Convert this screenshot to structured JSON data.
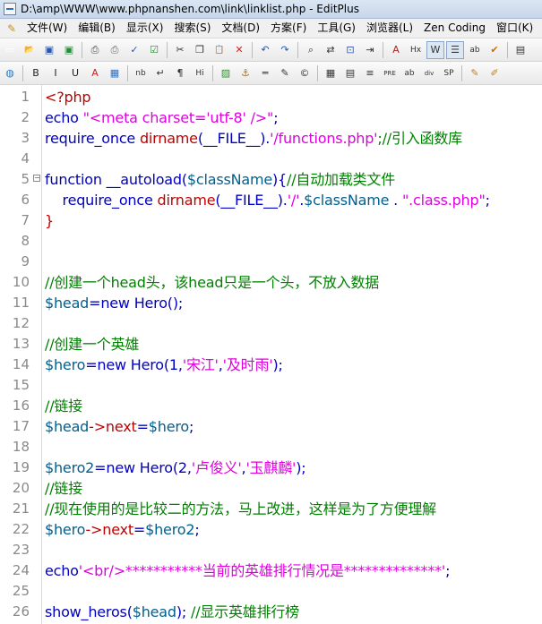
{
  "window": {
    "title": "D:\\amp\\WWW\\www.phpnanshen.com\\link\\linklist.php - EditPlus"
  },
  "menu": {
    "items": [
      {
        "label": "文件(W)"
      },
      {
        "label": "编辑(B)"
      },
      {
        "label": "显示(X)"
      },
      {
        "label": "搜索(S)"
      },
      {
        "label": "文档(D)"
      },
      {
        "label": "方案(F)"
      },
      {
        "label": "工具(G)"
      },
      {
        "label": "浏览器(L)"
      },
      {
        "label": "Zen Coding"
      },
      {
        "label": "窗口(K)"
      }
    ]
  },
  "toolbar1": {
    "buttons": [
      {
        "icon": "new-file-icon",
        "glyph": "▭",
        "color": "#ffffff"
      },
      {
        "icon": "open-folder-icon",
        "glyph": "📂",
        "color": "#e0b040"
      },
      {
        "icon": "save-icon",
        "glyph": "▣",
        "color": "#2a55a8"
      },
      {
        "icon": "save-all-icon",
        "glyph": "▣",
        "color": "#2a8a3a"
      },
      {
        "sep": true
      },
      {
        "icon": "print-icon",
        "glyph": "⎙",
        "color": "#444444"
      },
      {
        "icon": "print-preview-icon",
        "glyph": "⎙",
        "color": "#666666"
      },
      {
        "icon": "spell-check-icon",
        "glyph": "✓",
        "color": "#2a55a8"
      },
      {
        "icon": "check-icon",
        "glyph": "☑",
        "color": "#2a8a3a"
      },
      {
        "sep": true
      },
      {
        "icon": "cut-icon",
        "glyph": "✂",
        "color": "#333333"
      },
      {
        "icon": "copy-icon",
        "glyph": "❐",
        "color": "#333333"
      },
      {
        "icon": "paste-icon",
        "glyph": "📋",
        "color": "#a07030"
      },
      {
        "icon": "delete-icon",
        "glyph": "✕",
        "color": "#cc2222"
      },
      {
        "sep": true
      },
      {
        "icon": "undo-icon",
        "glyph": "↶",
        "color": "#2a55a8"
      },
      {
        "icon": "redo-icon",
        "glyph": "↷",
        "color": "#2a55a8"
      },
      {
        "sep": true
      },
      {
        "icon": "find-icon",
        "glyph": "⌕",
        "color": "#333333"
      },
      {
        "icon": "replace-icon",
        "glyph": "⇄",
        "color": "#333333"
      },
      {
        "icon": "find-in-files-icon",
        "glyph": "⊡",
        "color": "#2a55a8"
      },
      {
        "icon": "goto-line-icon",
        "glyph": "⇥",
        "color": "#333333"
      },
      {
        "sep": true
      },
      {
        "icon": "font-icon",
        "glyph": "A",
        "color": "#aa2222"
      },
      {
        "icon": "hex-icon",
        "glyph": "Hx",
        "color": "#333333"
      },
      {
        "icon": "word-wrap-icon",
        "glyph": "W",
        "color": "#333333",
        "pressed": true
      },
      {
        "icon": "ruler-icon",
        "glyph": "☰",
        "color": "#333333",
        "pressed": true
      },
      {
        "icon": "spell-toggle-icon",
        "glyph": "ab",
        "color": "#333333"
      },
      {
        "icon": "checkmark-icon",
        "glyph": "✔",
        "color": "#d26a00"
      },
      {
        "sep": true
      },
      {
        "icon": "toggle-panel-icon",
        "glyph": "▤",
        "color": "#333333"
      }
    ]
  },
  "toolbar2": {
    "buttons": [
      {
        "icon": "browser-icon",
        "glyph": "◍",
        "color": "#2a7ac0"
      },
      {
        "sep": true
      },
      {
        "icon": "bold-icon",
        "glyph": "B",
        "color": "#222222"
      },
      {
        "icon": "italic-icon",
        "glyph": "I",
        "color": "#222222"
      },
      {
        "icon": "underline-icon",
        "glyph": "U",
        "color": "#222222"
      },
      {
        "icon": "font-color-icon",
        "glyph": "A",
        "color": "#cc2222"
      },
      {
        "icon": "color-grid-icon",
        "glyph": "▦",
        "color": "#3070c0"
      },
      {
        "sep": true
      },
      {
        "icon": "nbsp-icon",
        "glyph": "nb",
        "color": "#333333"
      },
      {
        "icon": "break-icon",
        "glyph": "↵",
        "color": "#333333"
      },
      {
        "icon": "paragraph-icon",
        "glyph": "¶",
        "color": "#333333"
      },
      {
        "icon": "heading-icon",
        "glyph": "Hi",
        "color": "#333333"
      },
      {
        "sep": true
      },
      {
        "icon": "image-icon",
        "glyph": "▨",
        "color": "#3a8a3a"
      },
      {
        "icon": "anchor-icon",
        "glyph": "⚓",
        "color": "#a07030"
      },
      {
        "icon": "hr-icon",
        "glyph": "═",
        "color": "#333333"
      },
      {
        "icon": "comment-icon",
        "glyph": "✎",
        "color": "#333333"
      },
      {
        "icon": "copyright-icon",
        "glyph": "©",
        "color": "#333333"
      },
      {
        "sep": true
      },
      {
        "icon": "table-icon",
        "glyph": "▦",
        "color": "#333333"
      },
      {
        "icon": "form-icon",
        "glyph": "▤",
        "color": "#333333"
      },
      {
        "icon": "list-icon",
        "glyph": "≡",
        "color": "#333333"
      },
      {
        "icon": "pre-icon",
        "glyph": "PRE",
        "color": "#333333"
      },
      {
        "icon": "abbr-icon",
        "glyph": "ab",
        "color": "#333333"
      },
      {
        "icon": "div-icon",
        "glyph": "div",
        "color": "#333333"
      },
      {
        "icon": "span-icon",
        "glyph": "SP",
        "color": "#333333"
      },
      {
        "sep": true
      },
      {
        "icon": "edit-icon",
        "glyph": "✎",
        "color": "#c08020"
      },
      {
        "icon": "pencil-icon",
        "glyph": "✐",
        "color": "#c08020"
      }
    ]
  },
  "colors": {
    "keyword": "#0000c0",
    "string": "#e000e0",
    "comment": "#008000",
    "variable": "#006090",
    "func": "#c00000",
    "plain": "#000000",
    "linenum": "#8a8a8a"
  },
  "editor": {
    "lines": [
      {
        "n": "1",
        "tokens": [
          {
            "t": "<?php",
            "c": "func"
          }
        ]
      },
      {
        "n": "2",
        "tokens": [
          {
            "t": "echo ",
            "c": "keyword"
          },
          {
            "t": "\"<meta charset='utf-8' />\"",
            "c": "string"
          },
          {
            "t": ";",
            "c": "keyword"
          }
        ]
      },
      {
        "n": "3",
        "tokens": [
          {
            "t": "require_once ",
            "c": "keyword"
          },
          {
            "t": "dirname",
            "c": "func"
          },
          {
            "t": "(__FILE__).",
            "c": "keyword"
          },
          {
            "t": "'/functions.php'",
            "c": "string"
          },
          {
            "t": ";//引入函数库",
            "c": "comment"
          }
        ]
      },
      {
        "n": "4",
        "tokens": []
      },
      {
        "n": "5",
        "fold": true,
        "tokens": [
          {
            "t": "function __autoload(",
            "c": "keyword"
          },
          {
            "t": "$className",
            "c": "variable"
          },
          {
            "t": "){",
            "c": "keyword"
          },
          {
            "t": "//自动加载类文件",
            "c": "comment"
          }
        ]
      },
      {
        "n": "6",
        "tokens": [
          {
            "t": "    require_once ",
            "c": "keyword"
          },
          {
            "t": "dirname",
            "c": "func"
          },
          {
            "t": "(__FILE__).",
            "c": "keyword"
          },
          {
            "t": "'/'",
            "c": "string"
          },
          {
            "t": ".",
            "c": "keyword"
          },
          {
            "t": "$className",
            "c": "variable"
          },
          {
            "t": " . ",
            "c": "keyword"
          },
          {
            "t": "\".class.php\"",
            "c": "string"
          },
          {
            "t": ";",
            "c": "keyword"
          }
        ]
      },
      {
        "n": "7",
        "tokens": [
          {
            "t": "}",
            "c": "func"
          }
        ]
      },
      {
        "n": "8",
        "tokens": []
      },
      {
        "n": "9",
        "tokens": []
      },
      {
        "n": "10",
        "tokens": [
          {
            "t": "//创建一个head头，该head只是一个头，不放入数据",
            "c": "comment"
          }
        ]
      },
      {
        "n": "11",
        "tokens": [
          {
            "t": "$head",
            "c": "variable"
          },
          {
            "t": "=new Hero();",
            "c": "keyword"
          }
        ]
      },
      {
        "n": "12",
        "tokens": []
      },
      {
        "n": "13",
        "tokens": [
          {
            "t": "//创建一个英雄",
            "c": "comment"
          }
        ]
      },
      {
        "n": "14",
        "tokens": [
          {
            "t": "$hero",
            "c": "variable"
          },
          {
            "t": "=new Hero(1,",
            "c": "keyword"
          },
          {
            "t": "'宋江'",
            "c": "string"
          },
          {
            "t": ",",
            "c": "keyword"
          },
          {
            "t": "'及时雨'",
            "c": "string"
          },
          {
            "t": ");",
            "c": "keyword"
          }
        ]
      },
      {
        "n": "15",
        "tokens": []
      },
      {
        "n": "16",
        "tokens": [
          {
            "t": "//链接",
            "c": "comment"
          }
        ]
      },
      {
        "n": "17",
        "tokens": [
          {
            "t": "$head",
            "c": "variable"
          },
          {
            "t": "->",
            "c": "func"
          },
          {
            "t": "next",
            "c": "func"
          },
          {
            "t": "=",
            "c": "keyword"
          },
          {
            "t": "$hero",
            "c": "variable"
          },
          {
            "t": ";",
            "c": "keyword"
          }
        ]
      },
      {
        "n": "18",
        "tokens": []
      },
      {
        "n": "19",
        "tokens": [
          {
            "t": "$hero2",
            "c": "variable"
          },
          {
            "t": "=new Hero(2,",
            "c": "keyword"
          },
          {
            "t": "'卢俊义'",
            "c": "string"
          },
          {
            "t": ",",
            "c": "keyword"
          },
          {
            "t": "'玉麒麟'",
            "c": "string"
          },
          {
            "t": ");",
            "c": "keyword"
          }
        ]
      },
      {
        "n": "20",
        "tokens": [
          {
            "t": "//链接",
            "c": "comment"
          }
        ]
      },
      {
        "n": "21",
        "tokens": [
          {
            "t": "//现在使用的是比较二的方法，马上改进，这样是为了方便理解",
            "c": "comment"
          }
        ]
      },
      {
        "n": "22",
        "tokens": [
          {
            "t": "$hero",
            "c": "variable"
          },
          {
            "t": "->",
            "c": "func"
          },
          {
            "t": "next",
            "c": "func"
          },
          {
            "t": "=",
            "c": "keyword"
          },
          {
            "t": "$hero2",
            "c": "variable"
          },
          {
            "t": ";",
            "c": "keyword"
          }
        ]
      },
      {
        "n": "23",
        "tokens": []
      },
      {
        "n": "24",
        "tokens": [
          {
            "t": "echo",
            "c": "keyword"
          },
          {
            "t": "'<br/>***********当前的英雄排行情况是**************'",
            "c": "string"
          },
          {
            "t": ";",
            "c": "keyword"
          }
        ]
      },
      {
        "n": "25",
        "tokens": []
      },
      {
        "n": "26",
        "tokens": [
          {
            "t": "show_heros(",
            "c": "keyword"
          },
          {
            "t": "$head",
            "c": "variable"
          },
          {
            "t": "); ",
            "c": "keyword"
          },
          {
            "t": "//显示英雄排行榜",
            "c": "comment"
          }
        ]
      }
    ]
  }
}
